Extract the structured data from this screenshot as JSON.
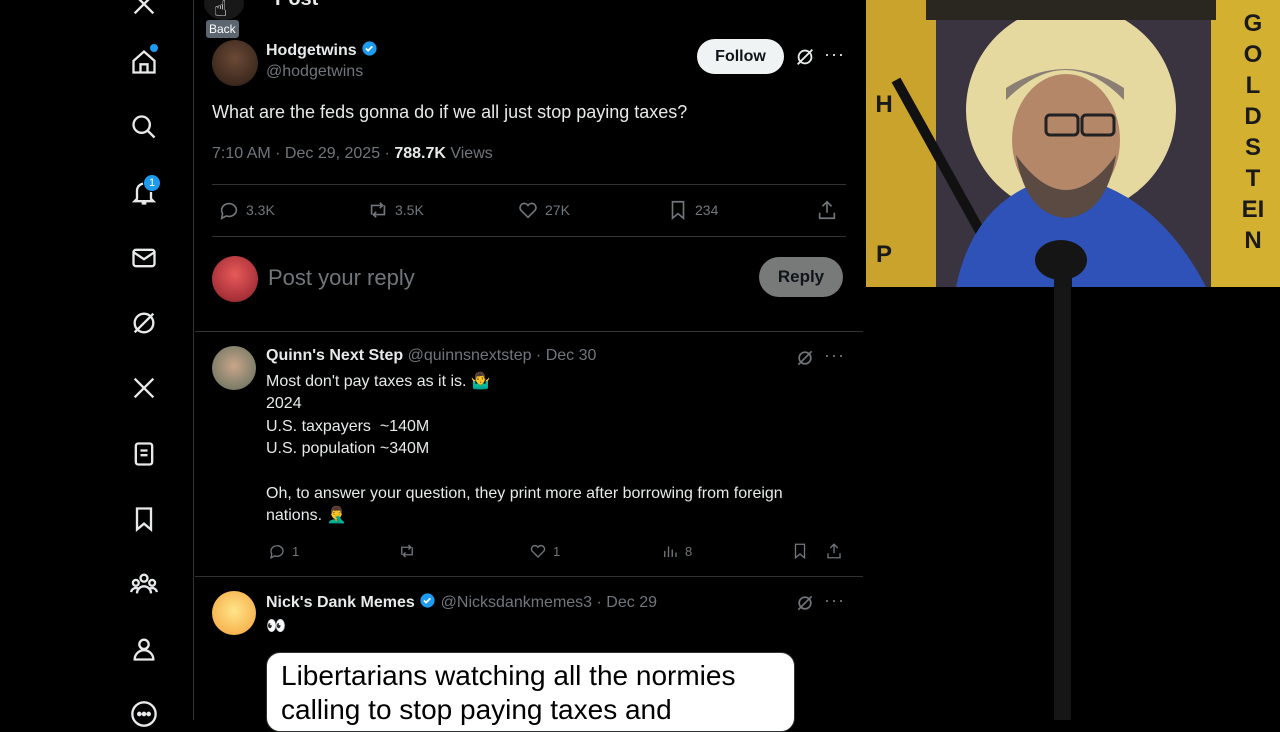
{
  "tooltip": {
    "back": "Back"
  },
  "header": {
    "title_partial": "Post"
  },
  "sidebar": {
    "notification_count": "1"
  },
  "post": {
    "author_name": "Hodgetwins",
    "author_handle": "@hodgetwins",
    "follow_label": "Follow",
    "text": "What are the feds gonna do if we all just stop paying taxes?",
    "time": "7:10 AM · Dec 29, 2025 · ",
    "views_count": "788.7K",
    "views_label": " Views",
    "replies": "3.3K",
    "reposts": "3.5K",
    "likes": "27K",
    "bookmarks": "234"
  },
  "composer": {
    "placeholder": "Post your reply",
    "reply_label": "Reply"
  },
  "replies": [
    {
      "name": "Quinn's Next Step",
      "handle": "@quinnsnextstep · Dec 30",
      "lines": [
        "Most don't pay taxes as it is. 🤷‍♂️",
        "2024",
        "U.S. taxpayers  ~140M",
        "U.S. population ~340M",
        "",
        "Oh, to answer your question, they print more after borrowing from foreign",
        "nations.  🤦‍♂️"
      ],
      "replies": "1",
      "reposts": "",
      "likes": "1",
      "views": "8"
    },
    {
      "name": "Nick's Dank Memes",
      "handle": "@Nicksdankmemes3 · Dec 29",
      "lines": [
        "👀"
      ],
      "meme_text": "Libertarians watching all the normies calling to stop paying taxes and"
    }
  ],
  "webcam": {
    "banner_letters": "GOLDSTEIN",
    "left_letters": "HP"
  },
  "colors": {
    "accent": "#1d9bf0",
    "bg": "#000000",
    "text": "#e7e9ea",
    "muted": "#71767b"
  }
}
